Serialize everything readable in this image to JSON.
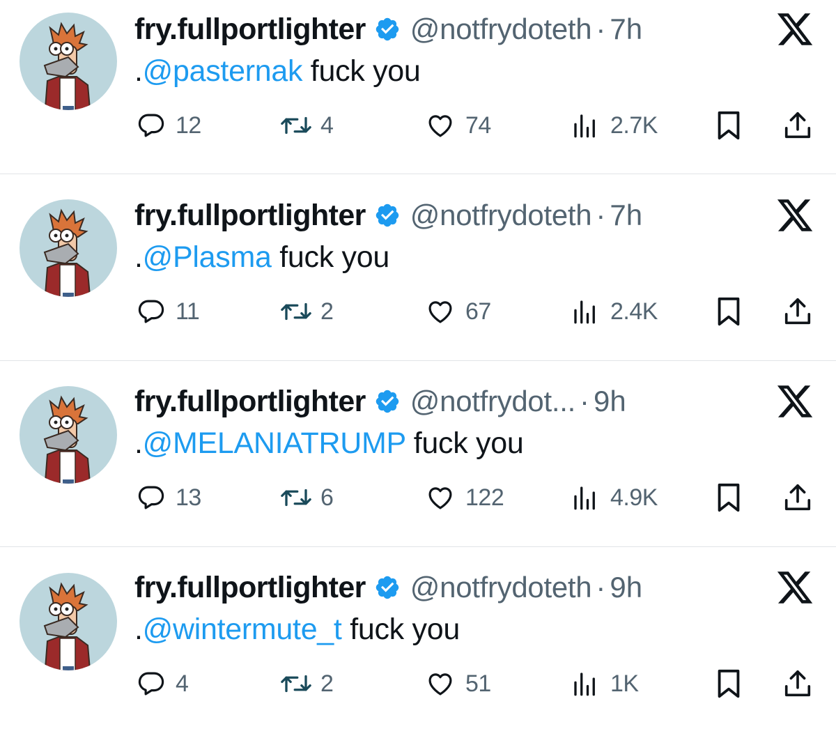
{
  "tweets": [
    {
      "display_name": "fry.fullportlighter",
      "handle": "@notfrydoteth",
      "separator": "·",
      "time": "7h",
      "text_prefix": ".",
      "mention": "@pasternak",
      "text_suffix": " fuck you",
      "replies": "12",
      "reposts": "4",
      "likes": "74",
      "views": "2.7K"
    },
    {
      "display_name": "fry.fullportlighter",
      "handle": "@notfrydoteth",
      "separator": "·",
      "time": "7h",
      "text_prefix": ".",
      "mention": "@Plasma",
      "text_suffix": " fuck you",
      "replies": "11",
      "reposts": "2",
      "likes": "67",
      "views": "2.4K"
    },
    {
      "display_name": "fry.fullportlighter",
      "handle": "@notfrydot...",
      "separator": "·",
      "time": "9h",
      "text_prefix": ".",
      "mention": "@MELANIATRUMP",
      "text_suffix": " fuck you",
      "replies": "13",
      "reposts": "6",
      "likes": "122",
      "views": "4.9K"
    },
    {
      "display_name": "fry.fullportlighter",
      "handle": "@notfrydoteth",
      "separator": "·",
      "time": "9h",
      "text_prefix": ".",
      "mention": "@wintermute_t",
      "text_suffix": " fuck you",
      "replies": "4",
      "reposts": "2",
      "likes": "51",
      "views": "1K"
    }
  ],
  "icons": {
    "verified": "verified-badge-icon",
    "platform": "x-logo-icon",
    "reply": "reply-icon",
    "repost": "repost-icon",
    "like": "heart-icon",
    "views": "views-icon",
    "bookmark": "bookmark-icon",
    "share": "share-icon"
  },
  "colors": {
    "accent": "#1d9bf0",
    "text": "#0f1419",
    "muted": "#536471",
    "divider": "#e1e4e7"
  }
}
